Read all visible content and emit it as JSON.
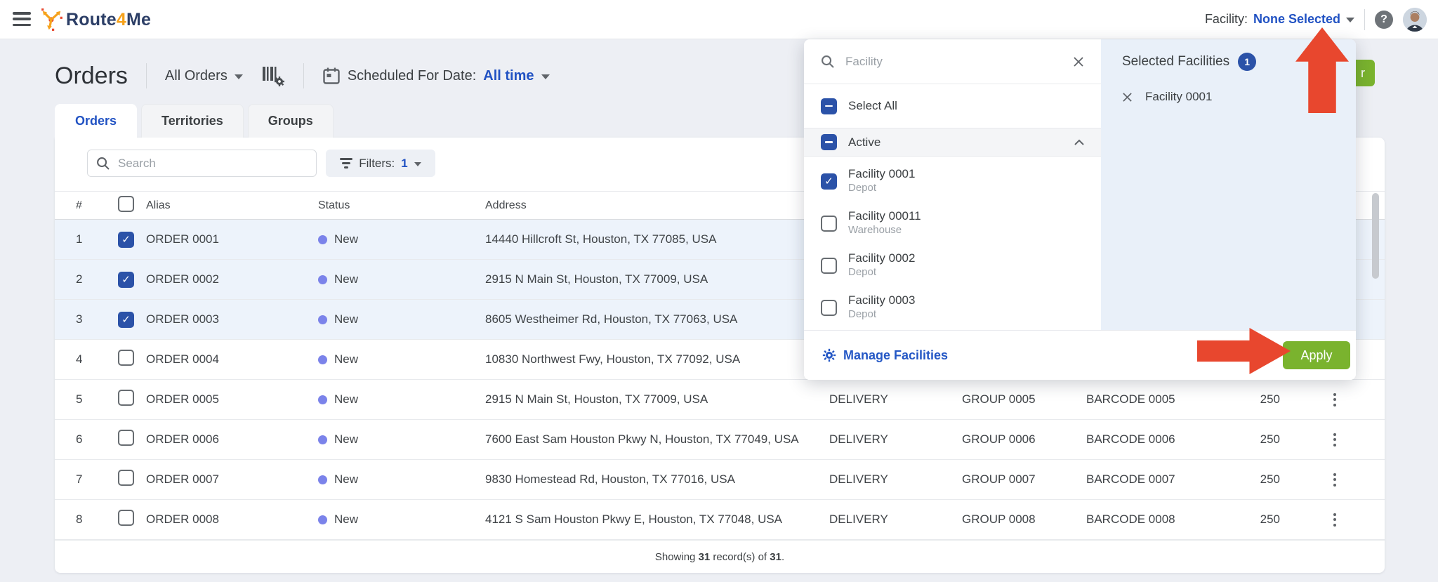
{
  "colors": {
    "accent_blue": "#2152c3",
    "checkbox_blue": "#2b52a8",
    "apply_green": "#7ab32e",
    "annotation_red": "#e8472e",
    "status_new_dot": "#7b83ea",
    "selected_row_bg": "#edf3fb"
  },
  "topbar": {
    "brand": "Route4Me",
    "facility_label": "Facility:",
    "facility_value": "None Selected",
    "help_glyph": "?"
  },
  "page": {
    "title": "Orders",
    "orders_scope": "All Orders",
    "schedule_label": "Scheduled For Date:",
    "schedule_value": "All time",
    "hidden_button_partial_label": "r"
  },
  "tabs": [
    {
      "label": "Orders",
      "active": true
    },
    {
      "label": "Territories",
      "active": false
    },
    {
      "label": "Groups",
      "active": false
    }
  ],
  "toolbar": {
    "search_placeholder": "Search",
    "filters_label": "Filters:",
    "filters_count": "1"
  },
  "table": {
    "headers": {
      "num": "#",
      "alias": "Alias",
      "status": "Status",
      "address": "Address",
      "type": "",
      "group": "",
      "barcode": "",
      "qty": ""
    },
    "rows": [
      {
        "num": "1",
        "alias": "ORDER 0001",
        "status": "New",
        "address": "14440 Hillcroft St, Houston, TX 77085, USA",
        "type": "",
        "group": "",
        "barcode": "",
        "qty": "",
        "selected": true,
        "checked": true
      },
      {
        "num": "2",
        "alias": "ORDER 0002",
        "status": "New",
        "address": "2915 N Main St, Houston, TX 77009, USA",
        "type": "",
        "group": "",
        "barcode": "",
        "qty": "",
        "selected": true,
        "checked": true
      },
      {
        "num": "3",
        "alias": "ORDER 0003",
        "status": "New",
        "address": "8605 Westheimer Rd, Houston, TX 77063, USA",
        "type": "",
        "group": "",
        "barcode": "",
        "qty": "",
        "selected": true,
        "checked": true
      },
      {
        "num": "4",
        "alias": "ORDER 0004",
        "status": "New",
        "address": "10830 Northwest Fwy, Houston, TX 77092, USA",
        "type": "",
        "group": "",
        "barcode": "",
        "qty": "",
        "selected": false,
        "checked": false
      },
      {
        "num": "5",
        "alias": "ORDER 0005",
        "status": "New",
        "address": "2915 N Main St, Houston, TX 77009, USA",
        "type": "DELIVERY",
        "group": "GROUP 0005",
        "barcode": "BARCODE 0005",
        "qty": "250",
        "selected": false,
        "checked": false
      },
      {
        "num": "6",
        "alias": "ORDER 0006",
        "status": "New",
        "address": "7600 East Sam Houston Pkwy N, Houston, TX 77049, USA",
        "type": "DELIVERY",
        "group": "GROUP 0006",
        "barcode": "BARCODE 0006",
        "qty": "250",
        "selected": false,
        "checked": false
      },
      {
        "num": "7",
        "alias": "ORDER 0007",
        "status": "New",
        "address": "9830 Homestead Rd, Houston, TX 77016, USA",
        "type": "DELIVERY",
        "group": "GROUP 0007",
        "barcode": "BARCODE 0007",
        "qty": "250",
        "selected": false,
        "checked": false
      },
      {
        "num": "8",
        "alias": "ORDER 0008",
        "status": "New",
        "address": "4121 S Sam Houston Pkwy E, Houston, TX 77048, USA",
        "type": "DELIVERY",
        "group": "GROUP 0008",
        "barcode": "BARCODE 0008",
        "qty": "250",
        "selected": false,
        "checked": false
      }
    ]
  },
  "footer": {
    "prefix": "Showing ",
    "count": "31",
    "middle": " record(s) of ",
    "total": "31",
    "suffix": "."
  },
  "facility_panel": {
    "search_placeholder": "Facility",
    "select_all_label": "Select All",
    "group_label": "Active",
    "items": [
      {
        "name": "Facility 0001",
        "sub": "Depot",
        "checked": true
      },
      {
        "name": "Facility 00011",
        "sub": "Warehouse",
        "checked": false
      },
      {
        "name": "Facility 0002",
        "sub": "Depot",
        "checked": false
      },
      {
        "name": "Facility 0003",
        "sub": "Depot",
        "checked": false
      }
    ],
    "manage_label": "Manage Facilities",
    "apply_label": "Apply",
    "selected": {
      "title": "Selected Facilities",
      "count": "1",
      "chips": [
        {
          "label": "Facility 0001"
        }
      ]
    }
  }
}
